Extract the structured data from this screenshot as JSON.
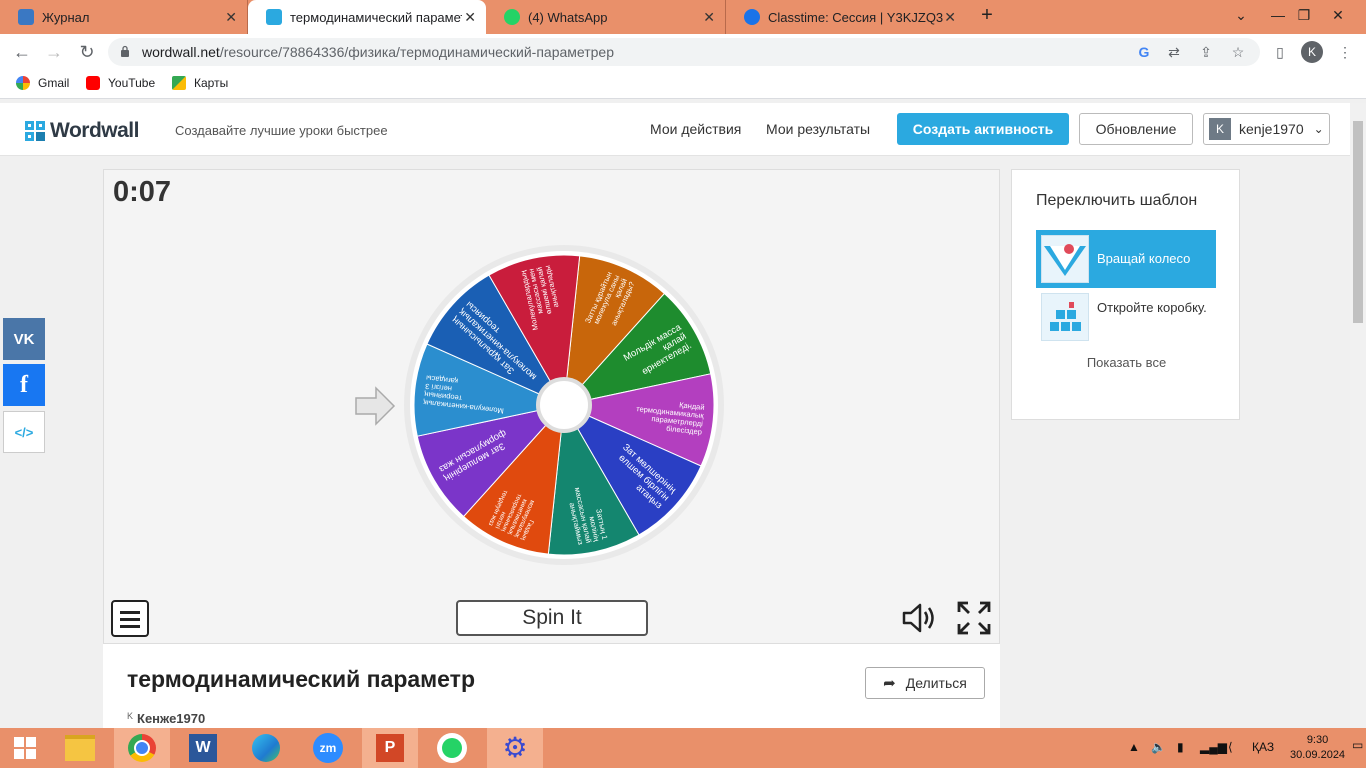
{
  "browser": {
    "tabs": [
      {
        "title": "Журнал"
      },
      {
        "title": "термодинамический параметр"
      },
      {
        "title": "(4) WhatsApp"
      },
      {
        "title": "Classtime: Сессия | Y3KJZQ3"
      }
    ],
    "new_tab_label": "+",
    "url_host": "wordwall.net",
    "url_path": "/resource/78864336/физика/термодинамический-параметрер",
    "profile_initial": "K",
    "bookmarks": [
      {
        "label": "Gmail"
      },
      {
        "label": "YouTube"
      },
      {
        "label": "Карты"
      }
    ]
  },
  "header": {
    "logo": "Wordwall",
    "tagline": "Создавайте лучшие уроки быстрее",
    "nav_my_activities": "Мои действия",
    "nav_my_results": "Мои результаты",
    "create_button": "Создать активность",
    "upgrade_button": "Обновление",
    "user_initial": "K",
    "username": "kenje1970"
  },
  "activity": {
    "timer": "0:07",
    "spin_button": "Spin It",
    "wheel_segments": [
      {
        "text": "Затты құрайтын молекула саны қалай анықталады?",
        "color": "#c8660b"
      },
      {
        "text": "Мольдік масса қалай өрнектеледі.",
        "color": "#1e8c2e"
      },
      {
        "text": "Қандай термодинамикалық параметрлерді білесіздер",
        "color": "#b33fbf"
      },
      {
        "text": "Зат мөлшерінің өлшем бірлігін атаңыз",
        "color": "#2a3fc4"
      },
      {
        "text": "Заттың 1 молінің массасын қалай анықтаймыз",
        "color": "#14866f"
      },
      {
        "text": "Газдың молекулалық кинетикалық теориясының негізгі теңдеуін жаз",
        "color": "#e04a0e"
      },
      {
        "text": "Зат мөлшерінің формуласын жаз",
        "color": "#7b35c9"
      },
      {
        "text": "Молекула-кинетикалық теорияның негізгі 3 қағидасы",
        "color": "#2b8ecf"
      },
      {
        "text": "Зат құрылысының молекула-кинетикалық теориясы",
        "color": "#1a5fb4"
      },
      {
        "text": "Молекулалардың массасы мен өлшемі қалай анықталады",
        "color": "#c91d3c"
      }
    ],
    "title": "термодинамический параметр",
    "author_initial": "K",
    "author": "Кенже1970",
    "share_button": "Делиться"
  },
  "templates": {
    "title": "Переключить шаблон",
    "items": [
      {
        "label": "Вращай колесо"
      },
      {
        "label": "Откройте коробку."
      }
    ],
    "show_all": "Показать все"
  },
  "social": {
    "vk": "VK",
    "embed": "</>"
  },
  "taskbar": {
    "language": "ҚАЗ",
    "time": "9:30",
    "date": "30.09.2024"
  },
  "colors": {
    "tab_strip": "#e9906a",
    "accent": "#2ba9e0",
    "vk": "#4a76a8",
    "facebook": "#1877f2"
  }
}
